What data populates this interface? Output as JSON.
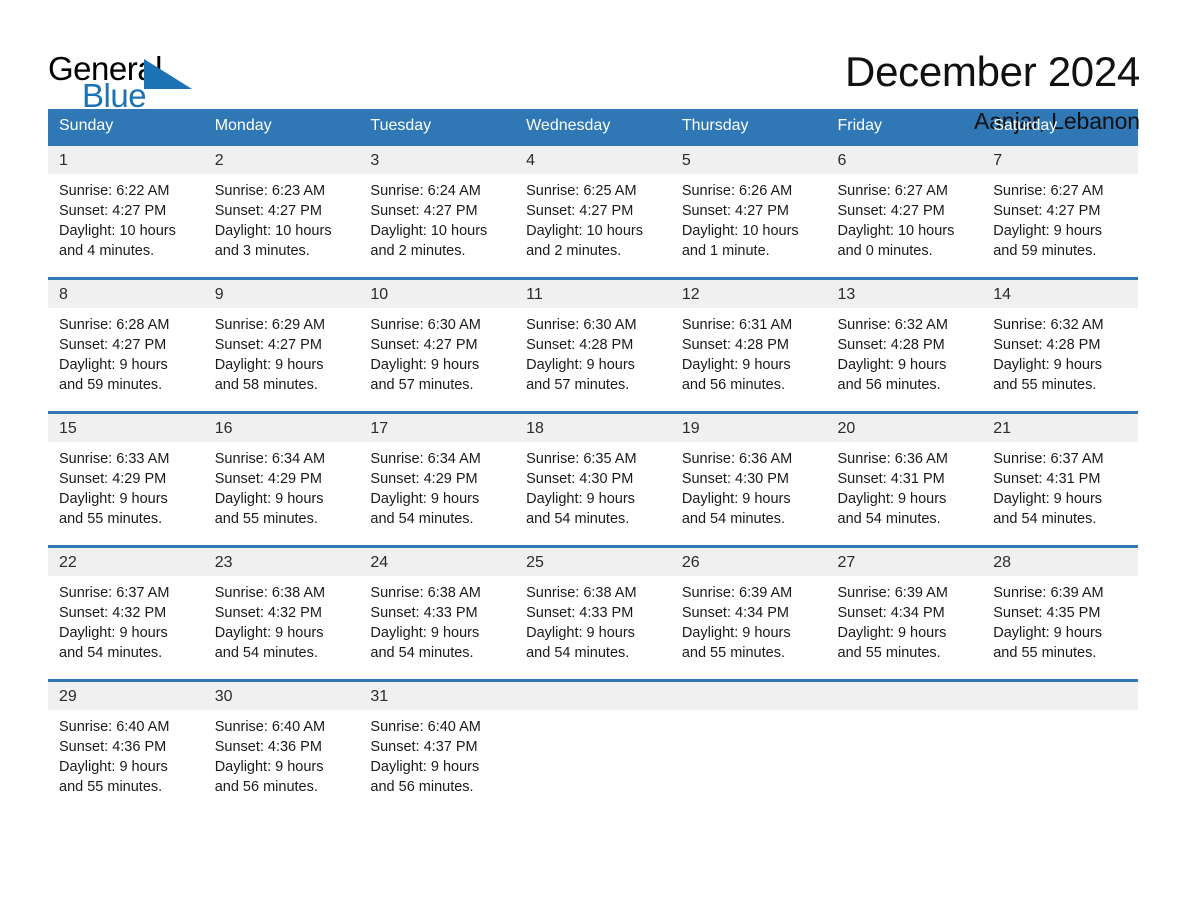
{
  "brand": {
    "name_top": "General",
    "name_bottom": "Blue",
    "accent_color": "#1b72b5"
  },
  "header": {
    "title": "December 2024",
    "subtitle": "Aanjar, Lebanon"
  },
  "calendar": {
    "header_bg": "#2f77b5",
    "header_text_color": "#ffffff",
    "daynum_band_bg": "#f0f0f0",
    "weekday_headers": [
      "Sunday",
      "Monday",
      "Tuesday",
      "Wednesday",
      "Thursday",
      "Friday",
      "Saturday"
    ],
    "weeks": [
      [
        {
          "day": "1",
          "sunrise": "Sunrise: 6:22 AM",
          "sunset": "Sunset: 4:27 PM",
          "daylight_line1": "Daylight: 10 hours",
          "daylight_line2": "and 4 minutes."
        },
        {
          "day": "2",
          "sunrise": "Sunrise: 6:23 AM",
          "sunset": "Sunset: 4:27 PM",
          "daylight_line1": "Daylight: 10 hours",
          "daylight_line2": "and 3 minutes."
        },
        {
          "day": "3",
          "sunrise": "Sunrise: 6:24 AM",
          "sunset": "Sunset: 4:27 PM",
          "daylight_line1": "Daylight: 10 hours",
          "daylight_line2": "and 2 minutes."
        },
        {
          "day": "4",
          "sunrise": "Sunrise: 6:25 AM",
          "sunset": "Sunset: 4:27 PM",
          "daylight_line1": "Daylight: 10 hours",
          "daylight_line2": "and 2 minutes."
        },
        {
          "day": "5",
          "sunrise": "Sunrise: 6:26 AM",
          "sunset": "Sunset: 4:27 PM",
          "daylight_line1": "Daylight: 10 hours",
          "daylight_line2": "and 1 minute."
        },
        {
          "day": "6",
          "sunrise": "Sunrise: 6:27 AM",
          "sunset": "Sunset: 4:27 PM",
          "daylight_line1": "Daylight: 10 hours",
          "daylight_line2": "and 0 minutes."
        },
        {
          "day": "7",
          "sunrise": "Sunrise: 6:27 AM",
          "sunset": "Sunset: 4:27 PM",
          "daylight_line1": "Daylight: 9 hours",
          "daylight_line2": "and 59 minutes."
        }
      ],
      [
        {
          "day": "8",
          "sunrise": "Sunrise: 6:28 AM",
          "sunset": "Sunset: 4:27 PM",
          "daylight_line1": "Daylight: 9 hours",
          "daylight_line2": "and 59 minutes."
        },
        {
          "day": "9",
          "sunrise": "Sunrise: 6:29 AM",
          "sunset": "Sunset: 4:27 PM",
          "daylight_line1": "Daylight: 9 hours",
          "daylight_line2": "and 58 minutes."
        },
        {
          "day": "10",
          "sunrise": "Sunrise: 6:30 AM",
          "sunset": "Sunset: 4:27 PM",
          "daylight_line1": "Daylight: 9 hours",
          "daylight_line2": "and 57 minutes."
        },
        {
          "day": "11",
          "sunrise": "Sunrise: 6:30 AM",
          "sunset": "Sunset: 4:28 PM",
          "daylight_line1": "Daylight: 9 hours",
          "daylight_line2": "and 57 minutes."
        },
        {
          "day": "12",
          "sunrise": "Sunrise: 6:31 AM",
          "sunset": "Sunset: 4:28 PM",
          "daylight_line1": "Daylight: 9 hours",
          "daylight_line2": "and 56 minutes."
        },
        {
          "day": "13",
          "sunrise": "Sunrise: 6:32 AM",
          "sunset": "Sunset: 4:28 PM",
          "daylight_line1": "Daylight: 9 hours",
          "daylight_line2": "and 56 minutes."
        },
        {
          "day": "14",
          "sunrise": "Sunrise: 6:32 AM",
          "sunset": "Sunset: 4:28 PM",
          "daylight_line1": "Daylight: 9 hours",
          "daylight_line2": "and 55 minutes."
        }
      ],
      [
        {
          "day": "15",
          "sunrise": "Sunrise: 6:33 AM",
          "sunset": "Sunset: 4:29 PM",
          "daylight_line1": "Daylight: 9 hours",
          "daylight_line2": "and 55 minutes."
        },
        {
          "day": "16",
          "sunrise": "Sunrise: 6:34 AM",
          "sunset": "Sunset: 4:29 PM",
          "daylight_line1": "Daylight: 9 hours",
          "daylight_line2": "and 55 minutes."
        },
        {
          "day": "17",
          "sunrise": "Sunrise: 6:34 AM",
          "sunset": "Sunset: 4:29 PM",
          "daylight_line1": "Daylight: 9 hours",
          "daylight_line2": "and 54 minutes."
        },
        {
          "day": "18",
          "sunrise": "Sunrise: 6:35 AM",
          "sunset": "Sunset: 4:30 PM",
          "daylight_line1": "Daylight: 9 hours",
          "daylight_line2": "and 54 minutes."
        },
        {
          "day": "19",
          "sunrise": "Sunrise: 6:36 AM",
          "sunset": "Sunset: 4:30 PM",
          "daylight_line1": "Daylight: 9 hours",
          "daylight_line2": "and 54 minutes."
        },
        {
          "day": "20",
          "sunrise": "Sunrise: 6:36 AM",
          "sunset": "Sunset: 4:31 PM",
          "daylight_line1": "Daylight: 9 hours",
          "daylight_line2": "and 54 minutes."
        },
        {
          "day": "21",
          "sunrise": "Sunrise: 6:37 AM",
          "sunset": "Sunset: 4:31 PM",
          "daylight_line1": "Daylight: 9 hours",
          "daylight_line2": "and 54 minutes."
        }
      ],
      [
        {
          "day": "22",
          "sunrise": "Sunrise: 6:37 AM",
          "sunset": "Sunset: 4:32 PM",
          "daylight_line1": "Daylight: 9 hours",
          "daylight_line2": "and 54 minutes."
        },
        {
          "day": "23",
          "sunrise": "Sunrise: 6:38 AM",
          "sunset": "Sunset: 4:32 PM",
          "daylight_line1": "Daylight: 9 hours",
          "daylight_line2": "and 54 minutes."
        },
        {
          "day": "24",
          "sunrise": "Sunrise: 6:38 AM",
          "sunset": "Sunset: 4:33 PM",
          "daylight_line1": "Daylight: 9 hours",
          "daylight_line2": "and 54 minutes."
        },
        {
          "day": "25",
          "sunrise": "Sunrise: 6:38 AM",
          "sunset": "Sunset: 4:33 PM",
          "daylight_line1": "Daylight: 9 hours",
          "daylight_line2": "and 54 minutes."
        },
        {
          "day": "26",
          "sunrise": "Sunrise: 6:39 AM",
          "sunset": "Sunset: 4:34 PM",
          "daylight_line1": "Daylight: 9 hours",
          "daylight_line2": "and 55 minutes."
        },
        {
          "day": "27",
          "sunrise": "Sunrise: 6:39 AM",
          "sunset": "Sunset: 4:34 PM",
          "daylight_line1": "Daylight: 9 hours",
          "daylight_line2": "and 55 minutes."
        },
        {
          "day": "28",
          "sunrise": "Sunrise: 6:39 AM",
          "sunset": "Sunset: 4:35 PM",
          "daylight_line1": "Daylight: 9 hours",
          "daylight_line2": "and 55 minutes."
        }
      ],
      [
        {
          "day": "29",
          "sunrise": "Sunrise: 6:40 AM",
          "sunset": "Sunset: 4:36 PM",
          "daylight_line1": "Daylight: 9 hours",
          "daylight_line2": "and 55 minutes."
        },
        {
          "day": "30",
          "sunrise": "Sunrise: 6:40 AM",
          "sunset": "Sunset: 4:36 PM",
          "daylight_line1": "Daylight: 9 hours",
          "daylight_line2": "and 56 minutes."
        },
        {
          "day": "31",
          "sunrise": "Sunrise: 6:40 AM",
          "sunset": "Sunset: 4:37 PM",
          "daylight_line1": "Daylight: 9 hours",
          "daylight_line2": "and 56 minutes."
        },
        {
          "day": "",
          "sunrise": "",
          "sunset": "",
          "daylight_line1": "",
          "daylight_line2": ""
        },
        {
          "day": "",
          "sunrise": "",
          "sunset": "",
          "daylight_line1": "",
          "daylight_line2": ""
        },
        {
          "day": "",
          "sunrise": "",
          "sunset": "",
          "daylight_line1": "",
          "daylight_line2": ""
        },
        {
          "day": "",
          "sunrise": "",
          "sunset": "",
          "daylight_line1": "",
          "daylight_line2": ""
        }
      ]
    ]
  }
}
